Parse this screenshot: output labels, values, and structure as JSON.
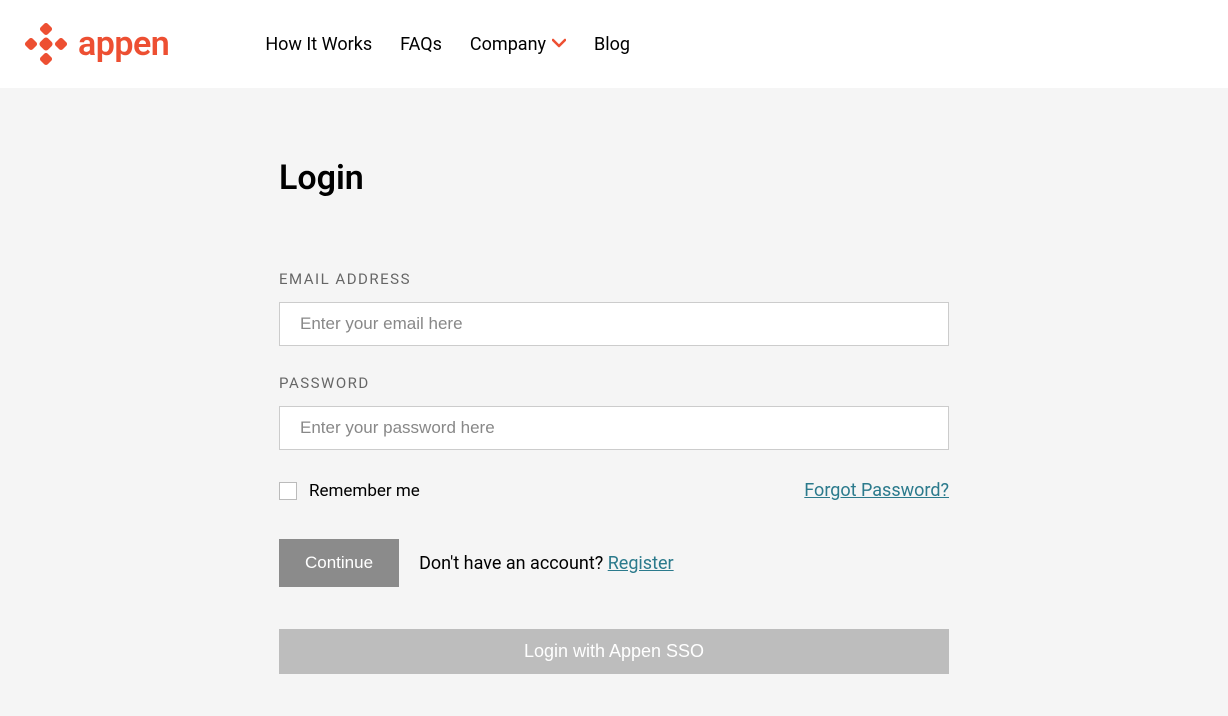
{
  "brand": {
    "name": "appen",
    "color": "#ED4F32"
  },
  "nav": {
    "items": [
      {
        "label": "How It Works",
        "hasDropdown": false
      },
      {
        "label": "FAQs",
        "hasDropdown": false
      },
      {
        "label": "Company",
        "hasDropdown": true
      },
      {
        "label": "Blog",
        "hasDropdown": false
      }
    ]
  },
  "login": {
    "title": "Login",
    "email": {
      "label": "EMAIL ADDRESS",
      "placeholder": "Enter your email here",
      "value": ""
    },
    "password": {
      "label": "PASSWORD",
      "placeholder": "Enter your password here",
      "value": ""
    },
    "remember": {
      "label": "Remember me",
      "checked": false
    },
    "forgot": "Forgot Password?",
    "continue": "Continue",
    "noAccount": "Don't have an account? ",
    "register": "Register",
    "sso": "Login with Appen SSO"
  }
}
